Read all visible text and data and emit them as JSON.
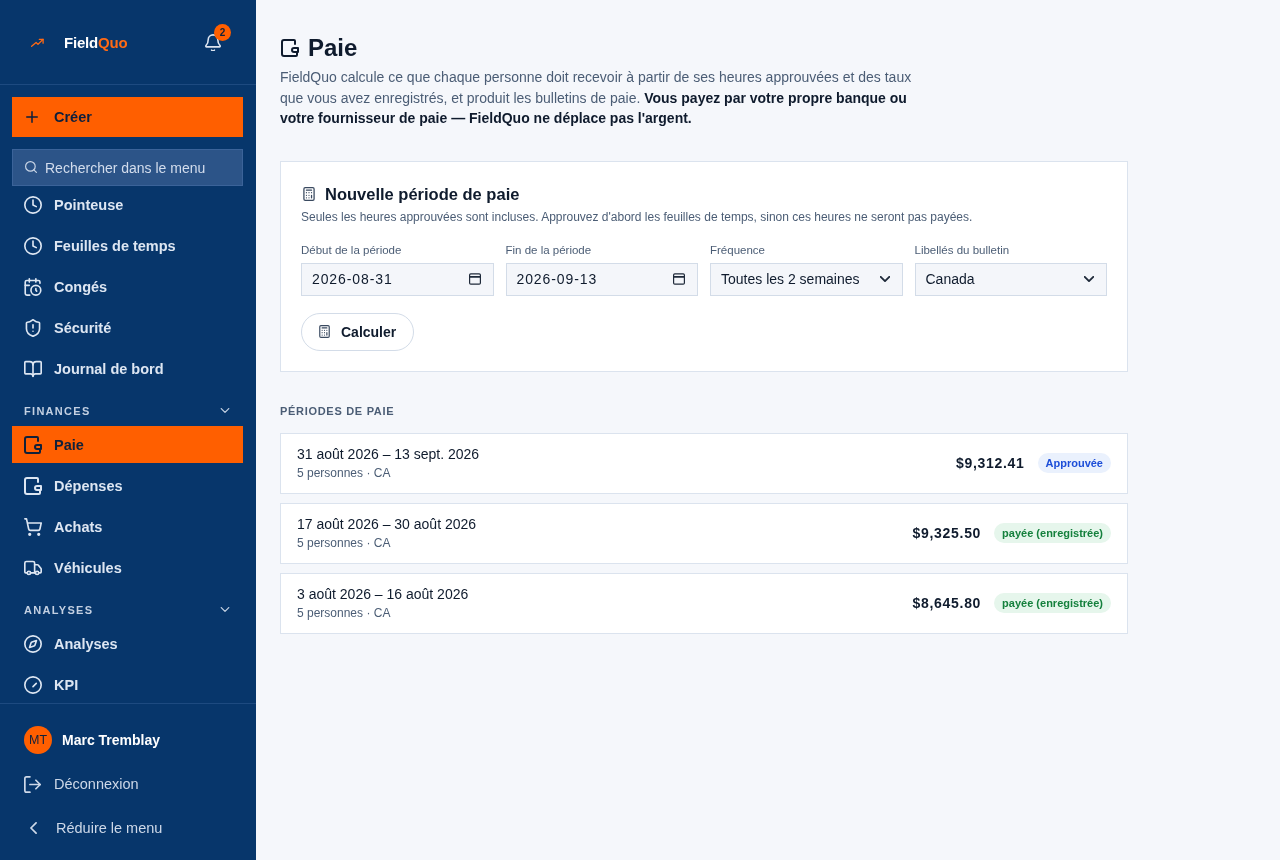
{
  "sidebar": {
    "logo": {
      "primary": "Field",
      "accent": "Quo"
    },
    "notifications": {
      "count": "2"
    },
    "create_button": {
      "label": "Créer"
    },
    "search": {
      "placeholder": "Rechercher dans le menu"
    },
    "groups": [
      {
        "items": [
          {
            "label": "Pointeuse",
            "selected": false
          },
          {
            "label": "Feuilles de temps",
            "selected": false
          },
          {
            "label": "Congés",
            "selected": false
          },
          {
            "label": "Sécurité",
            "selected": false
          },
          {
            "label": "Journal de bord",
            "selected": false
          }
        ]
      },
      {
        "title": "FINANCES",
        "expanded": true,
        "items": [
          {
            "label": "Paie",
            "selected": true
          },
          {
            "label": "Dépenses",
            "selected": false
          },
          {
            "label": "Achats",
            "selected": false
          },
          {
            "label": "Véhicules",
            "selected": false
          }
        ]
      },
      {
        "title": "ANALYSES",
        "expanded": true,
        "items": [
          {
            "label": "Analyses",
            "selected": false
          },
          {
            "label": "KPI",
            "selected": false
          }
        ]
      }
    ],
    "user": {
      "initials": "MT",
      "name": "Marc Tremblay"
    },
    "footer_items": [
      {
        "label": "Déconnexion"
      },
      {
        "label": "Réduire le menu"
      }
    ]
  },
  "page": {
    "title": "Paie",
    "description": "FieldQuo calcule ce que chaque personne doit recevoir à partir de ses heures approuvées et des taux que vous avez enregistrés, et produit les bulletins de paie. **Vous payez par votre propre banque ou votre fournisseur de paie — FieldQuo ne déplace pas l'argent.**"
  },
  "new_period": {
    "title": "Nouvelle période de paie",
    "hint": "Seules les heures approuvées sont incluses. Approuvez d'abord les feuilles de temps, sinon ces heures ne seront pas payées.",
    "fields": [
      {
        "kind": "date",
        "label": "Début de la période",
        "value": "2026-08-31"
      },
      {
        "kind": "date",
        "label": "Fin de la période",
        "value": "2026-09-13"
      },
      {
        "kind": "select",
        "label": "Fréquence",
        "value": "Toutes les 2 semaines"
      },
      {
        "kind": "select",
        "label": "Libellés du bulletin",
        "value": "Canada"
      }
    ],
    "button": {
      "label": "Calculer"
    }
  },
  "periods": {
    "heading": "PÉRIODES DE PAIE",
    "items": [
      {
        "dates": "31 août 2026 – 13 sept. 2026",
        "details": "5 personnes · CA",
        "amount": "$9,312.41",
        "status": {
          "kind": "approved",
          "label": "Approuvée"
        }
      },
      {
        "dates": "17 août 2026 – 30 août 2026",
        "details": "5 personnes · CA",
        "amount": "$9,325.50",
        "status": {
          "kind": "paid",
          "label": "payée (enregistrée)"
        }
      },
      {
        "dates": "3 août 2026 – 16 août 2026",
        "details": "5 personnes · CA",
        "amount": "$8,645.80",
        "status": {
          "kind": "paid",
          "label": "payée (enregistrée)"
        }
      }
    ]
  }
}
